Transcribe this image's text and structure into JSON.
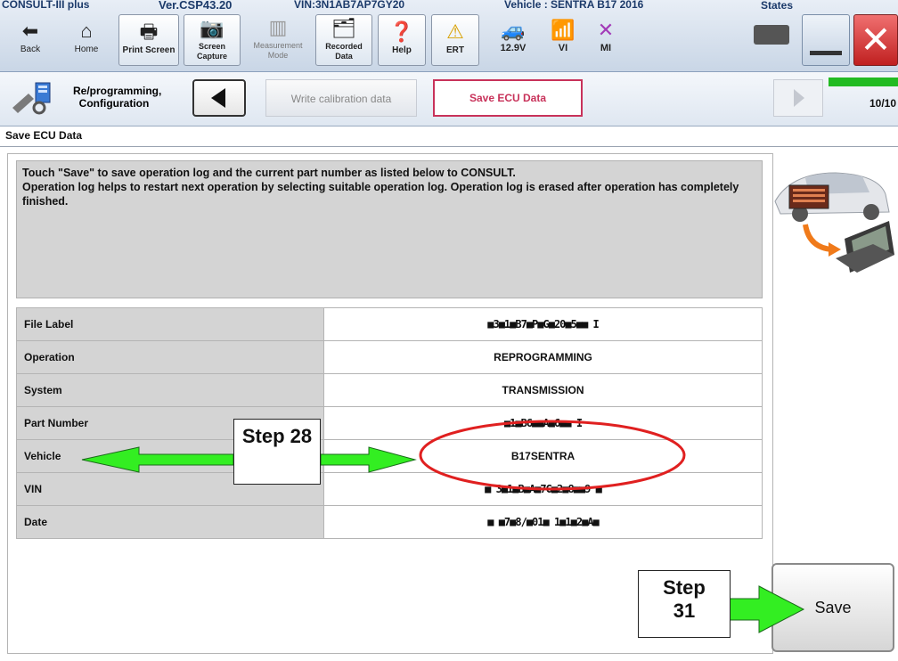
{
  "titlebar": {
    "left": "CONSULT-III plus",
    "version": "Ver.CSP43.20",
    "middle": "VIN:3N1AB7AP7GY20",
    "vehicle": "Vehicle : SENTRA B17 2016",
    "country": "States"
  },
  "toolbar": {
    "back": "Back",
    "home": "Home",
    "print_screen": "Print Screen",
    "screen_capture": "Screen Capture",
    "measurement_mode": "Measurement Mode",
    "recorded_data": "Recorded Data",
    "help": "Help",
    "ert": "ERT",
    "battery": "12.9V",
    "vi": "VI",
    "mi": "MI"
  },
  "breadcrumb": {
    "step1": "Re/programming, Configuration",
    "step2": "Write calibration data",
    "step3": "Save ECU Data",
    "progress": "10/10",
    "progress_fraction": 1.0
  },
  "page": {
    "title": "Save ECU Data",
    "message_line1": "Touch \"Save\" to save operation log and the current part number as listed below to CONSULT.",
    "message_line2": "Operation log helps to restart next operation by selecting suitable operation log. Operation log is erased after operation has completely finished."
  },
  "table": {
    "rows": [
      {
        "label": "File Label",
        "value": "■3■1■B7■P■G■20■5■■ I"
      },
      {
        "label": "Operation",
        "value": "REPROGRAMMING"
      },
      {
        "label": "System",
        "value": "TRANSMISSION"
      },
      {
        "label": "Part Number",
        "value": "■1■B6■■A■6■■ I"
      },
      {
        "label": "Vehicle",
        "value": "B17SENTRA"
      },
      {
        "label": "VIN",
        "value": "■ 3■1■B■A■7G■2■8■■9 ■"
      },
      {
        "label": "Date",
        "value": "■ ■7■8/■01■ 1■1■2■A■"
      }
    ]
  },
  "actions": {
    "save": "Save"
  },
  "annotations": {
    "step28": "Step 28",
    "step31": "Step 31"
  },
  "colors": {
    "arrow_green": "#33ee22",
    "ellipse_red": "#e02020",
    "active_crumb_border": "#c8325a",
    "progress_green": "#22bb22"
  }
}
